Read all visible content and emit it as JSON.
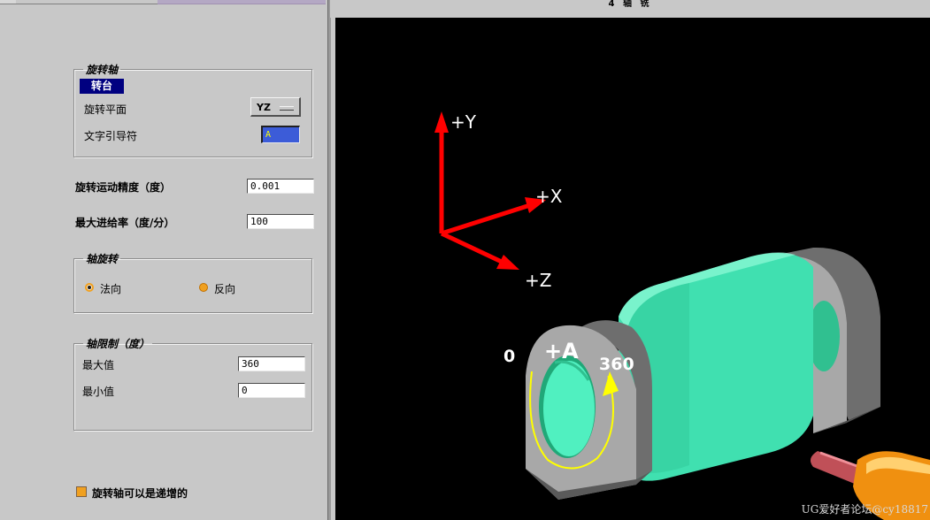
{
  "viewport": {
    "title": "4 轴 铣",
    "axis_labels": {
      "y": "+Y",
      "x": "+X",
      "z": "+Z"
    },
    "dimension_labels": {
      "start": "0",
      "axis": "+A",
      "end": "360"
    },
    "watermark": "UG爱好者论坛@cy18817"
  },
  "rotary_axis": {
    "legend": "旋转轴",
    "selected_item": "转台",
    "rotation_plane_label": "旋转平面",
    "rotation_plane_value": "YZ",
    "text_lead_label": "文字引导符",
    "text_lead_value": "A"
  },
  "precision": {
    "label": "旋转运动精度（度）",
    "value": "0.001"
  },
  "max_feedrate": {
    "label": "最大进给率（度/分）",
    "value": "100"
  },
  "axis_rotation": {
    "legend": "轴旋转",
    "normal_label": "法向",
    "reverse_label": "反向",
    "selected": "normal"
  },
  "axis_limits": {
    "legend": "轴限制（度）",
    "max_label": "最大值",
    "max_value": "360",
    "min_label": "最小值",
    "min_value": "0"
  },
  "incremental": {
    "label": "旋转轴可以是递增的",
    "checked": true
  },
  "colors": {
    "axis_red": "#ff0000",
    "part_green": "#40e0b0",
    "fixture_gray": "#a8a8a8",
    "arrow_yellow": "#ffff00",
    "selection_navy": "#000080",
    "background": "#000000"
  }
}
